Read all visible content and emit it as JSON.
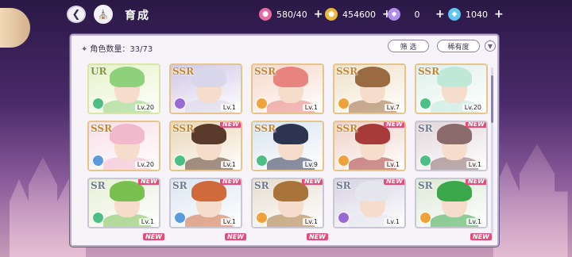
{
  "header": {
    "title": "育成",
    "resources": [
      {
        "name": "candy-icon",
        "value": "580/40",
        "color": "#e86aa0"
      },
      {
        "name": "coin-icon",
        "value": "454600",
        "color": "#e9b93a"
      },
      {
        "name": "purple-gem-icon",
        "value": "0",
        "color": "#b28bea"
      },
      {
        "name": "blue-gem-icon",
        "value": "1040",
        "color": "#5fc6f0"
      }
    ],
    "plus": "+"
  },
  "panel": {
    "count_label": "角色数量：33/73",
    "filter_label": "筛 选",
    "sort_label": "稀有度"
  },
  "cards": [
    {
      "rarity": "UR",
      "level": "Lv.20",
      "new": false,
      "attr": "#4bbf84",
      "hair": "#8fd07a",
      "bg": "#e6f2c9",
      "cls": "ur"
    },
    {
      "rarity": "SSR",
      "level": "Lv.1",
      "new": false,
      "attr": "#9a6ad4",
      "hair": "#d8d6ea",
      "bg": "#cfc6e6",
      "cls": "ssr"
    },
    {
      "rarity": "SSR",
      "level": "Lv.1",
      "new": false,
      "attr": "#f0a23a",
      "hair": "#e8847f",
      "bg": "#f6d7c9",
      "cls": "ssr"
    },
    {
      "rarity": "SSR",
      "level": "Lv.7",
      "new": false,
      "attr": "#f0a23a",
      "hair": "#9a6a42",
      "bg": "#efe0c6",
      "cls": "ssr"
    },
    {
      "rarity": "SSR",
      "level": "Lv.20",
      "new": false,
      "attr": "#4bbf84",
      "hair": "#bfe8d8",
      "bg": "#dff0ea",
      "cls": "ssr"
    },
    {
      "rarity": "SSR",
      "level": "Lv.20",
      "new": false,
      "attr": "#5a9be0",
      "hair": "#f2b9cc",
      "bg": "#f7dfe6",
      "cls": "ssr"
    },
    {
      "rarity": "SSR",
      "level": "Lv.1",
      "new": true,
      "attr": "#4bbf84",
      "hair": "#5a3a2a",
      "bg": "#e8d5b4",
      "cls": "ssr"
    },
    {
      "rarity": "SSR",
      "level": "Lv.9",
      "new": false,
      "attr": "#4bbf84",
      "hair": "#2c3450",
      "bg": "#d8e4ef",
      "cls": "ssr"
    },
    {
      "rarity": "SSR",
      "level": "Lv.1",
      "new": true,
      "attr": "#f0a23a",
      "hair": "#a83a3a",
      "bg": "#efd0c6",
      "cls": "ssr"
    },
    {
      "rarity": "SR",
      "level": "Lv.1",
      "new": true,
      "attr": "#4bbf84",
      "hair": "#8a6a6a",
      "bg": "#e2d6da",
      "cls": "sr"
    },
    {
      "rarity": "SR",
      "level": "Lv.1",
      "new": true,
      "attr": "#4bbf84",
      "hair": "#7ac050",
      "bg": "#e6efd6",
      "cls": "sr"
    },
    {
      "rarity": "SR",
      "level": "Lv.1",
      "new": true,
      "attr": "#5a9be0",
      "hair": "#d06a3a",
      "bg": "#dbe6f2",
      "cls": "sr"
    },
    {
      "rarity": "SR",
      "level": "Lv.1",
      "new": true,
      "attr": "#f0a23a",
      "hair": "#a8743a",
      "bg": "#e6dccf",
      "cls": "sr"
    },
    {
      "rarity": "SR",
      "level": "Lv.1",
      "new": true,
      "attr": "#9a6ad4",
      "hair": "#e6e6ee",
      "bg": "#d6d2e2",
      "cls": "sr"
    },
    {
      "rarity": "SR",
      "level": "Lv.1",
      "new": true,
      "attr": "#f0a23a",
      "hair": "#3aa84a",
      "bg": "#dbe9d6",
      "cls": "sr"
    }
  ],
  "next_row_badges": [
    "NEW",
    "NEW",
    "NEW",
    "NEW"
  ]
}
